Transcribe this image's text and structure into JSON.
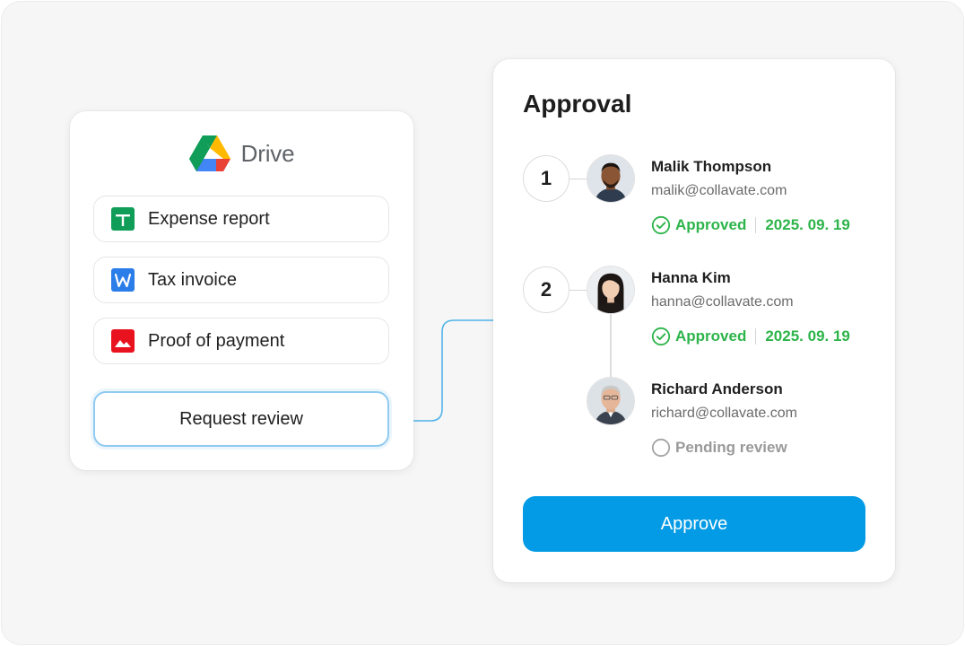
{
  "drive": {
    "title": "Drive",
    "files": [
      {
        "label": "Expense report",
        "icon": "google-sheets-icon",
        "color": "#0f9d58"
      },
      {
        "label": "Tax invoice",
        "icon": "word-doc-icon",
        "color": "#2b7de9"
      },
      {
        "label": "Proof of payment",
        "icon": "image-file-icon",
        "color": "#e8131e"
      }
    ],
    "request_label": "Request review"
  },
  "approval": {
    "title": "Approval",
    "steps": [
      {
        "number": "1",
        "approvers": [
          {
            "name": "Malik Thompson",
            "email": "malik@collavate.com",
            "status": "Approved",
            "date": "2025. 09. 19"
          }
        ]
      },
      {
        "number": "2",
        "approvers": [
          {
            "name": "Hanna Kim",
            "email": "hanna@collavate.com",
            "status": "Approved",
            "date": "2025. 09. 19"
          },
          {
            "name": "Richard Anderson",
            "email": "richard@collavate.com",
            "status": "Pending review"
          }
        ]
      }
    ],
    "approve_label": "Approve"
  },
  "colors": {
    "accent": "#039be5",
    "approved": "#2db44a",
    "pending": "#9a9a9a",
    "connector": "#4fb3ea"
  }
}
